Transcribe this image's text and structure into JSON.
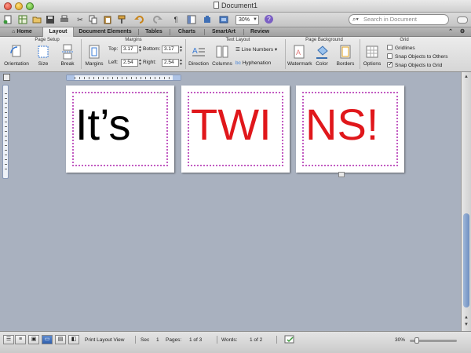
{
  "window": {
    "title": "Document1"
  },
  "toolbar": {
    "zoom": "30%",
    "search_placeholder": "Search in Document"
  },
  "tabs": [
    "Home",
    "Layout",
    "Document Elements",
    "Tables",
    "Charts",
    "SmartArt",
    "Review"
  ],
  "active_tab": "Layout",
  "ribbon": {
    "page_setup": {
      "title": "Page Setup",
      "orientation": "Orientation",
      "size": "Size",
      "break": "Break"
    },
    "margins": {
      "title": "Margins",
      "button": "Margins",
      "top_label": "Top:",
      "top_value": "3.17",
      "bottom_label": "Bottom:",
      "bottom_value": "3.17",
      "left_label": "Left:",
      "left_value": "2.54",
      "right_label": "Right:",
      "right_value": "2.54"
    },
    "text_layout": {
      "title": "Text Layout",
      "direction": "Direction",
      "columns": "Columns",
      "line_numbers": "Line Numbers",
      "hyphenation": "Hyphenation"
    },
    "page_background": {
      "title": "Page Background",
      "watermark": "Watermark",
      "color": "Color",
      "borders": "Borders"
    },
    "grid": {
      "title": "Grid",
      "options": "Options",
      "gridlines": "Gridlines",
      "snap_objects_to_others": "Snap Objects to Others",
      "snap_objects_to_grid": "Snap Objects to Grid"
    }
  },
  "pages": [
    {
      "text": "It’s",
      "color": "#000000"
    },
    {
      "text": "TWI",
      "color": "#e0171b"
    },
    {
      "text": "NS!",
      "color": "#e0171b"
    }
  ],
  "status": {
    "view": "Print Layout View",
    "sec_label": "Sec",
    "sec_value": "1",
    "pages_label": "Pages:",
    "pages_value": "1 of 3",
    "words_label": "Words:",
    "words_value": "1 of 2",
    "zoom": "30%"
  }
}
